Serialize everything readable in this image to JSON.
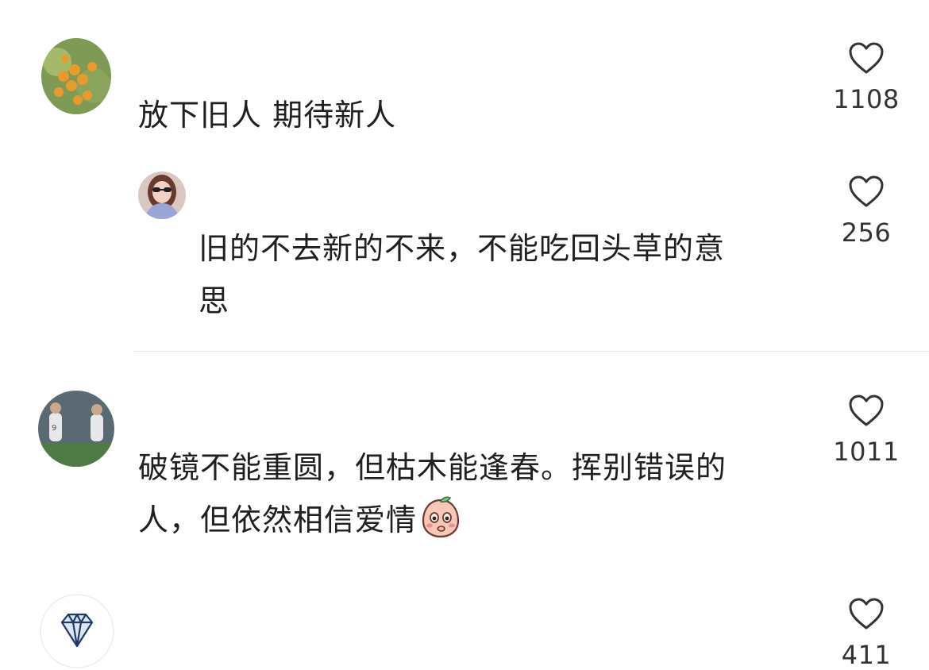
{
  "comments": [
    {
      "text": "放下旧人 期待新人",
      "likes": "1108",
      "avatar_icon": "orange-tree-avatar"
    },
    {
      "text": "旧的不去新的不来，不能吃回头草的意\n思",
      "likes": "256",
      "avatar_icon": "woman-sunglasses-avatar",
      "is_reply": true
    },
    {
      "text": "破镜不能重圆，但枯木能逢春。挥别错误的\n人，但依然相信爱情",
      "likes": "1011",
      "avatar_icon": "soccer-players-avatar",
      "trailing_emoji": "peach-blush-emoji"
    },
    {
      "text": "",
      "likes": "411",
      "avatar_icon": "diamond-avatar"
    }
  ],
  "icons": {
    "like": "heart-outline-icon"
  },
  "colors": {
    "text": "#202020",
    "count": "#333333",
    "divider": "#e6e6e6"
  }
}
